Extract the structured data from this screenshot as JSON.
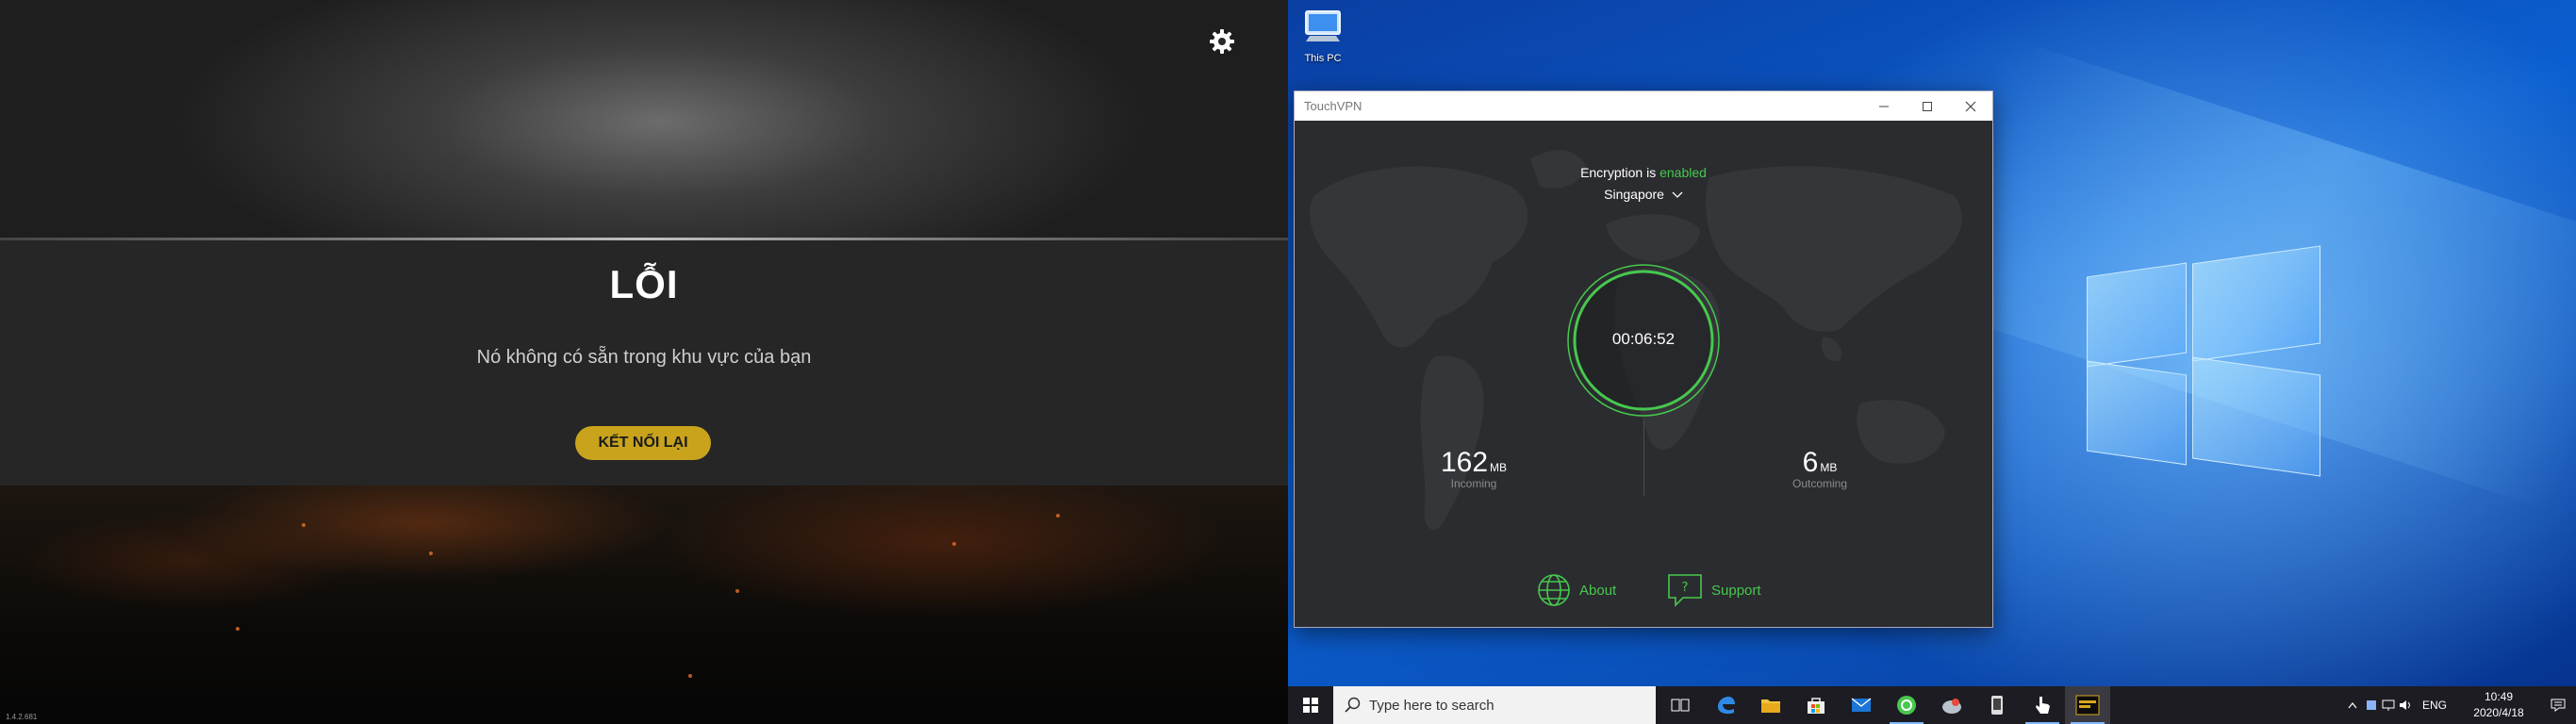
{
  "game": {
    "error_title": "LỖI",
    "error_message": "Nó không có sẵn trong khu vực của bạn",
    "reconnect_label": "KẾT NỐI LẠI",
    "version": "1.4.2.681",
    "settings_icon": "gear-icon"
  },
  "desktop": {
    "icons": [
      {
        "label": "This PC",
        "icon": "computer-icon"
      }
    ]
  },
  "vpn": {
    "window_title": "TouchVPN",
    "encryption_prefix": "Encryption is",
    "encryption_status": "enabled",
    "location": "Singapore",
    "timer": "00:06:52",
    "incoming_value": "162",
    "incoming_unit": "MB",
    "incoming_label": "Incoming",
    "outgoing_value": "6",
    "outgoing_unit": "MB",
    "outgoing_label": "Outcoming",
    "about_label": "About",
    "support_label": "Support",
    "colors": {
      "accent": "#46c84e",
      "background": "#2b2c2f"
    }
  },
  "taskbar": {
    "search_placeholder": "Type here to search",
    "language": "ENG",
    "time": "10:49",
    "date": "2020/4/18",
    "pinned": [
      "task-view-icon",
      "edge-icon",
      "file-explorer-icon",
      "store-icon",
      "mail-icon",
      "green-app-icon",
      "satellite-app-icon",
      "phone-app-icon",
      "touch-app-icon",
      "pubg-icon"
    ]
  }
}
